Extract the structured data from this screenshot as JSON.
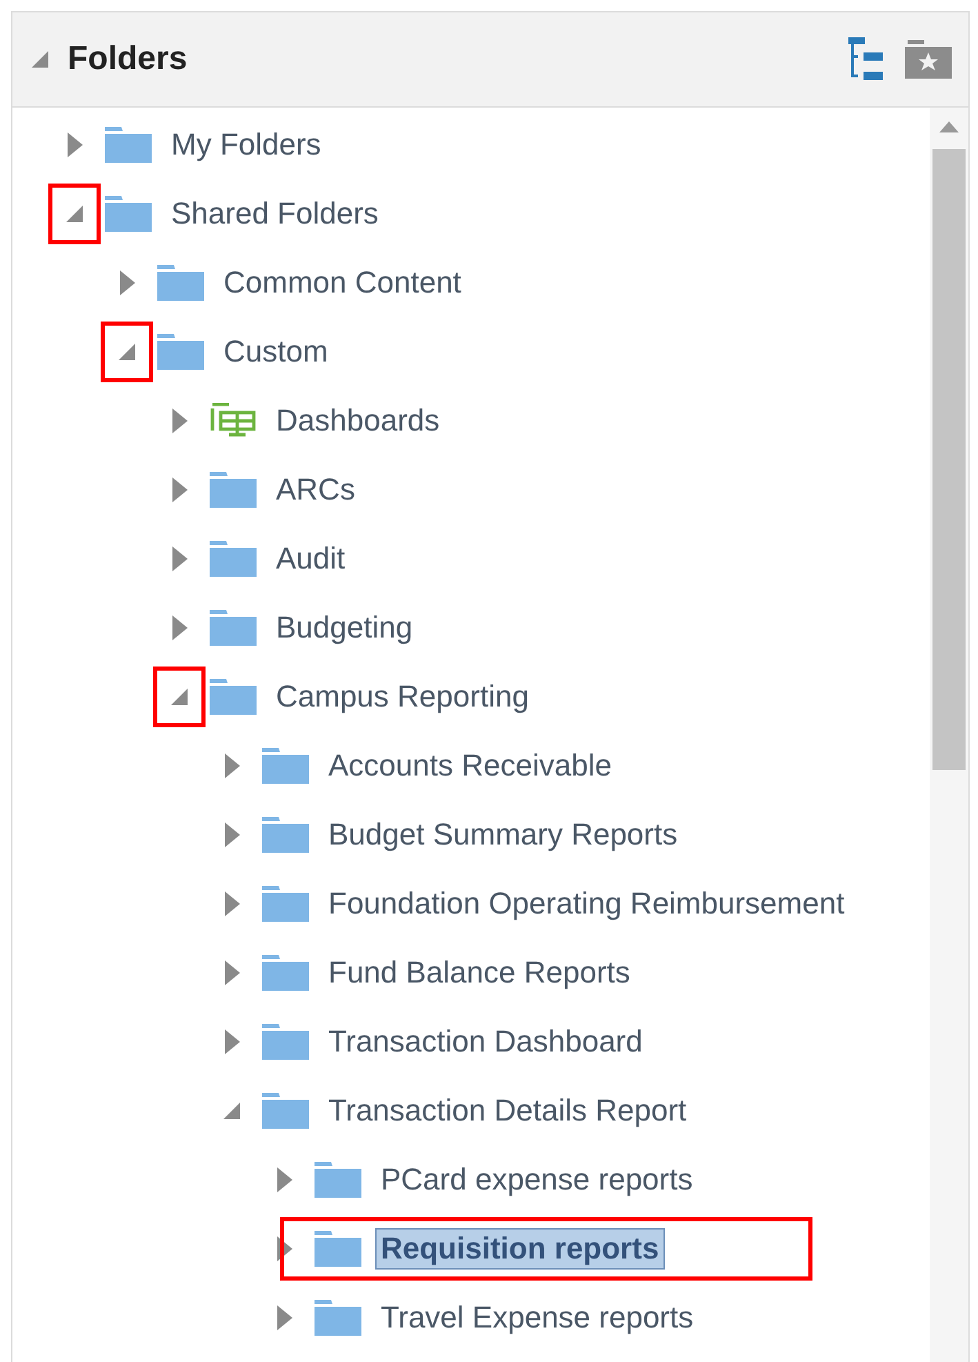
{
  "panel": {
    "title": "Folders",
    "expanded": true
  },
  "tree": [
    {
      "label": "My Folders",
      "kind": "folder",
      "expanded": false,
      "selected": false,
      "toggle_marked": false,
      "row_marked": false
    },
    {
      "label": "Shared Folders",
      "kind": "folder",
      "expanded": true,
      "selected": false,
      "toggle_marked": true,
      "row_marked": false,
      "children": [
        {
          "label": "Common Content",
          "kind": "folder",
          "expanded": false,
          "selected": false,
          "toggle_marked": false,
          "row_marked": false
        },
        {
          "label": "Custom",
          "kind": "folder",
          "expanded": true,
          "selected": false,
          "toggle_marked": true,
          "row_marked": false,
          "children": [
            {
              "label": "Dashboards",
              "kind": "dashboards",
              "expanded": false,
              "selected": false,
              "toggle_marked": false,
              "row_marked": false
            },
            {
              "label": "ARCs",
              "kind": "folder",
              "expanded": false,
              "selected": false,
              "toggle_marked": false,
              "row_marked": false
            },
            {
              "label": "Audit",
              "kind": "folder",
              "expanded": false,
              "selected": false,
              "toggle_marked": false,
              "row_marked": false
            },
            {
              "label": "Budgeting",
              "kind": "folder",
              "expanded": false,
              "selected": false,
              "toggle_marked": false,
              "row_marked": false
            },
            {
              "label": "Campus Reporting",
              "kind": "folder",
              "expanded": true,
              "selected": false,
              "toggle_marked": true,
              "row_marked": false,
              "children": [
                {
                  "label": "Accounts Receivable",
                  "kind": "folder",
                  "expanded": false,
                  "selected": false,
                  "toggle_marked": false,
                  "row_marked": false
                },
                {
                  "label": "Budget Summary Reports",
                  "kind": "folder",
                  "expanded": false,
                  "selected": false,
                  "toggle_marked": false,
                  "row_marked": false
                },
                {
                  "label": "Foundation Operating Reimbursement",
                  "kind": "folder",
                  "expanded": false,
                  "selected": false,
                  "toggle_marked": false,
                  "row_marked": false
                },
                {
                  "label": "Fund Balance Reports",
                  "kind": "folder",
                  "expanded": false,
                  "selected": false,
                  "toggle_marked": false,
                  "row_marked": false
                },
                {
                  "label": "Transaction Dashboard",
                  "kind": "folder",
                  "expanded": false,
                  "selected": false,
                  "toggle_marked": false,
                  "row_marked": false
                },
                {
                  "label": "Transaction Details Report",
                  "kind": "folder",
                  "expanded": true,
                  "selected": false,
                  "toggle_marked": false,
                  "row_marked": false,
                  "children": [
                    {
                      "label": "PCard expense reports",
                      "kind": "folder",
                      "expanded": false,
                      "selected": false,
                      "toggle_marked": false,
                      "row_marked": false
                    },
                    {
                      "label": "Requisition reports",
                      "kind": "folder",
                      "expanded": false,
                      "selected": true,
                      "toggle_marked": false,
                      "row_marked": true
                    },
                    {
                      "label": "Travel Expense reports",
                      "kind": "folder",
                      "expanded": false,
                      "selected": false,
                      "toggle_marked": false,
                      "row_marked": false
                    }
                  ]
                }
              ]
            }
          ]
        }
      ]
    }
  ]
}
